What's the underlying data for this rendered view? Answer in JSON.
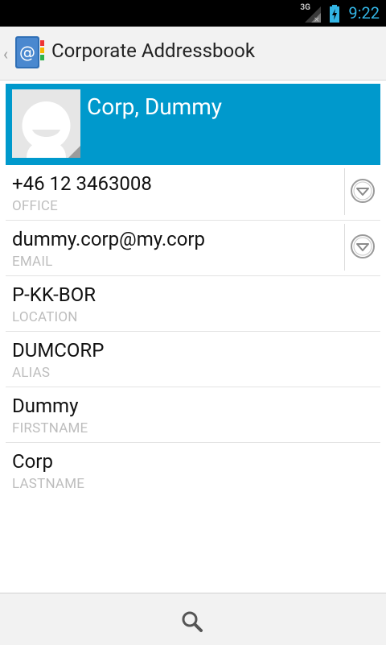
{
  "status": {
    "network": "3G",
    "time": "9:22"
  },
  "actionbar": {
    "title": "Corporate Addressbook"
  },
  "contact": {
    "display_name": "Corp, Dummy"
  },
  "fields": [
    {
      "value": "+46 12 3463008",
      "label": "OFFICE",
      "has_action": true
    },
    {
      "value": "dummy.corp@my.corp",
      "label": "EMAIL",
      "has_action": true
    },
    {
      "value": "P-KK-BOR",
      "label": "LOCATION",
      "has_action": false
    },
    {
      "value": "DUMCORP",
      "label": "ALIAS",
      "has_action": false
    },
    {
      "value": "Dummy",
      "label": "FIRSTNAME",
      "has_action": false
    },
    {
      "value": "Corp",
      "label": "LASTNAME",
      "has_action": false
    }
  ],
  "colors": {
    "accent": "#33b5e5",
    "header_bg": "#0099cc"
  },
  "icons": {
    "app": "addressbook-icon",
    "search": "search-icon",
    "row_action": "dropdown-circle-icon"
  }
}
